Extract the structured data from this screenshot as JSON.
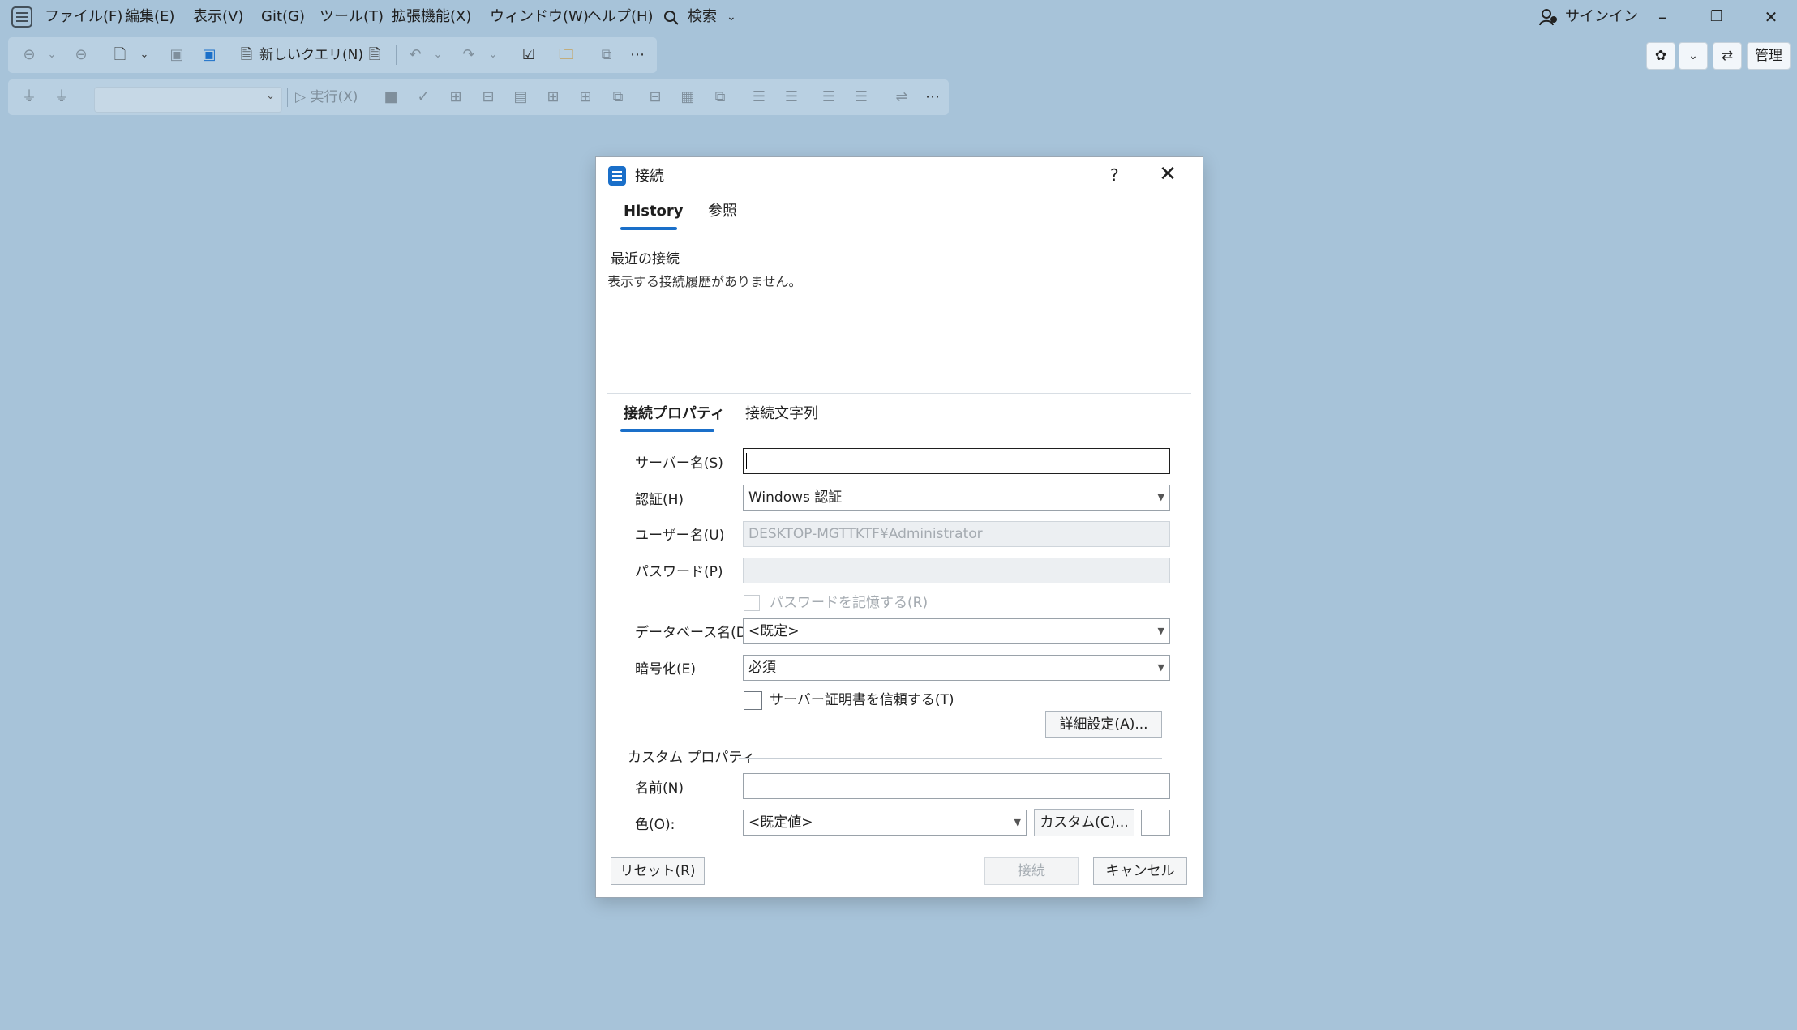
{
  "menu": {
    "items": [
      "ファイル(F)",
      "編集(E)",
      "表示(V)",
      "Git(G)",
      "ツール(T)",
      "拡張機能(X)",
      "ウィンドウ(W)",
      "ヘルプ(H)"
    ],
    "search_label": "検索",
    "signin_label": "サインイン"
  },
  "toolbar1": {
    "new_query_label": "新しいクエリ(N)"
  },
  "toolbar2": {
    "execute_label": "実行(X)"
  },
  "right_toolbar": {
    "admin_label": "管理"
  },
  "dialog": {
    "title": "接続",
    "help": "?",
    "tabs": [
      "History",
      "参照"
    ],
    "recent_heading": "最近の接続",
    "recent_empty": "表示する接続履歴がありません。",
    "sub_tabs": [
      "接続プロパティ",
      "接続文字列"
    ],
    "fields": {
      "server_label": "サーバー名(S)",
      "server_value": "",
      "auth_label": "認証(H)",
      "auth_value": "Windows 認証",
      "user_label": "ユーザー名(U)",
      "user_value": "DESKTOP-MGTTKTF¥Administrator",
      "password_label": "パスワード(P)",
      "password_value": "",
      "remember_password_label": "パスワードを記憶する(R)",
      "database_label": "データベース名(D)",
      "database_value": "<既定>",
      "encrypt_label": "暗号化(E)",
      "encrypt_value": "必須",
      "trust_cert_label": "サーバー証明書を信頼する(T)",
      "advanced_button": "詳細設定(A)..."
    },
    "custom": {
      "group_label": "カスタム プロパティ",
      "name_label": "名前(N)",
      "name_value": "",
      "color_label": "色(O):",
      "color_value": "<既定値>",
      "custom_button": "カスタム(C)..."
    },
    "footer": {
      "reset_button": "リセット(R)",
      "connect_button": "接続",
      "cancel_button": "キャンセル"
    }
  },
  "colors": {
    "background": "#a7c3d9",
    "accent": "#1a6fc9"
  }
}
